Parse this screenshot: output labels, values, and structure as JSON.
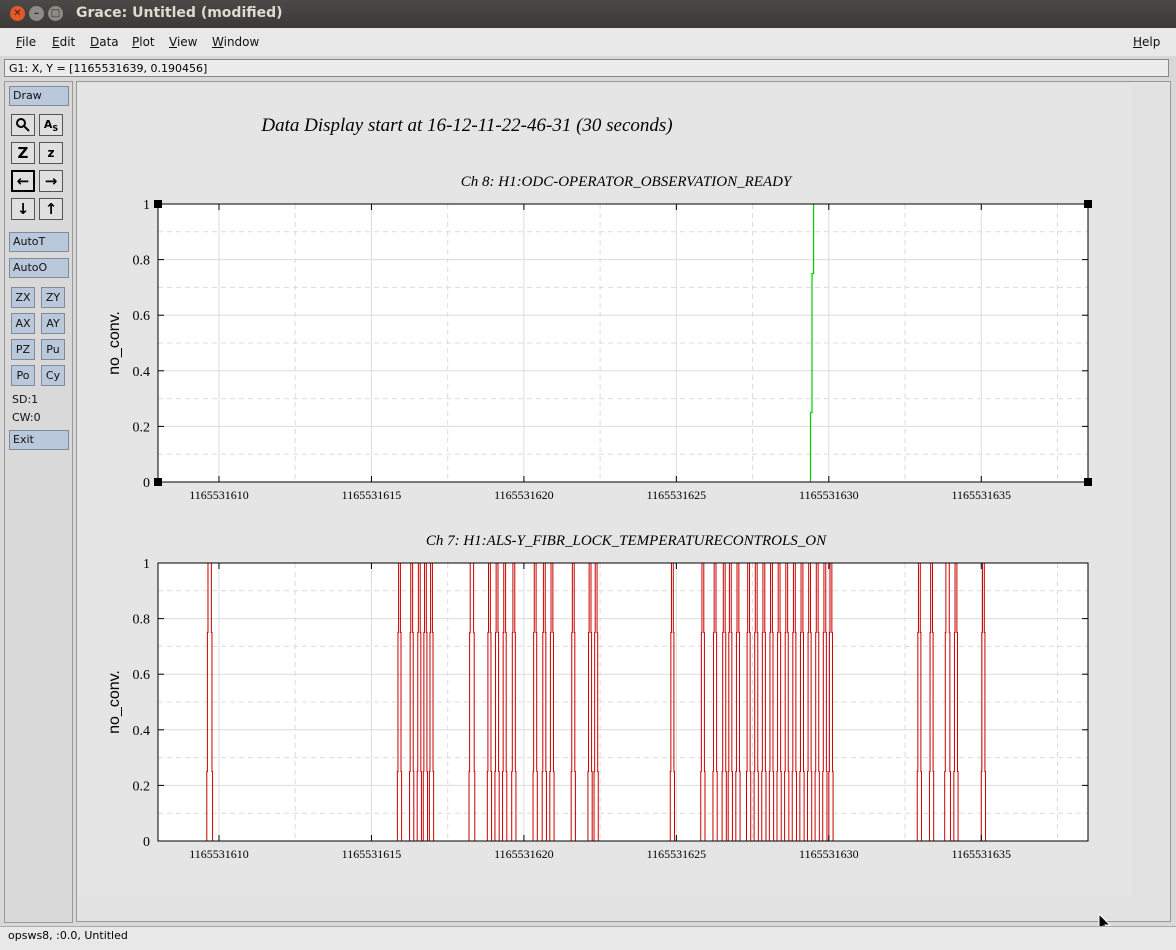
{
  "window": {
    "title": "Grace: Untitled (modified)"
  },
  "menu": {
    "file": "File",
    "edit": "Edit",
    "data": "Data",
    "plot": "Plot",
    "view": "View",
    "window": "Window",
    "help": "Help"
  },
  "locator": "G1: X, Y = [1165531639, 0.190456]",
  "toolbar": {
    "draw": "Draw",
    "autot": "AutoT",
    "autoo": "AutoO",
    "zx": "ZX",
    "zy": "ZY",
    "ax": "AX",
    "ay": "AY",
    "pz": "PZ",
    "pu": "Pu",
    "po": "Po",
    "cy": "Cy",
    "sd": "SD:1",
    "cw": "CW:0",
    "exit": "Exit",
    "icons": [
      "zoom-icon",
      "autoscale-icon",
      "zoom-in-z-icon",
      "zoom-out-z-icon",
      "pan-left-icon",
      "pan-right-icon",
      "pan-down-icon",
      "pan-up-icon"
    ]
  },
  "plot_title": "Data Display start at 16-12-11-22-46-31 (30 seconds)",
  "status": "opsws8, :0.0, Untitled",
  "colors": {
    "ch8": "#00cc00",
    "ch7": "#cc0000"
  },
  "chart_data": [
    {
      "type": "line",
      "title": "Ch 8: H1:ODC-OPERATOR_OBSERVATION_READY",
      "ylabel": "no_conv.",
      "xlim": [
        1165531608,
        1165531638.5
      ],
      "ylim": [
        0,
        1
      ],
      "xticks": [
        1165531610,
        1165531615,
        1165531620,
        1165531625,
        1165531630,
        1165531635
      ],
      "xtick_labels": [
        "1165531610",
        "1165531615",
        "1165531620",
        "1165531625",
        "1165531630",
        "1165531635"
      ],
      "yticks": [
        0,
        0.2,
        0.4,
        0.6,
        0.8,
        1
      ],
      "ytick_labels": [
        "0",
        "0.2",
        "0.4",
        "0.6",
        "0.8",
        "1"
      ],
      "grid": true,
      "series": [
        {
          "x": [
            1165531629.4,
            1165531629.4,
            1165531629.45,
            1165531629.45,
            1165531629.5,
            1165531629.5
          ],
          "y": [
            0,
            0.25,
            0.25,
            0.75,
            0.75,
            1
          ]
        }
      ]
    },
    {
      "type": "line",
      "title": "Ch 7: H1:ALS-Y_FIBR_LOCK_TEMPERATURECONTROLS_ON",
      "ylabel": "no_conv.",
      "xlim": [
        1165531608,
        1165531638.5
      ],
      "ylim": [
        0,
        1
      ],
      "xticks": [
        1165531610,
        1165531615,
        1165531620,
        1165531625,
        1165531630,
        1165531635
      ],
      "xtick_labels": [
        "1165531610",
        "1165531615",
        "1165531620",
        "1165531625",
        "1165531630",
        "1165531635"
      ],
      "yticks": [
        0,
        0.2,
        0.4,
        0.6,
        0.8,
        1
      ],
      "ytick_labels": [
        "0",
        "0.2",
        "0.4",
        "0.6",
        "0.8",
        "1"
      ],
      "grid": true,
      "pulses": [
        [
          1165531609.6,
          1165531609.75
        ],
        [
          1165531615.85,
          1165531615.95
        ],
        [
          1165531616.25,
          1165531616.35
        ],
        [
          1165531616.5,
          1165531616.6
        ],
        [
          1165531616.7,
          1165531616.8
        ],
        [
          1165531616.9,
          1165531617.0
        ],
        [
          1165531618.2,
          1165531618.35
        ],
        [
          1165531618.8,
          1165531618.9
        ],
        [
          1165531619.05,
          1165531619.15
        ],
        [
          1165531619.3,
          1165531619.4
        ],
        [
          1165531619.6,
          1165531619.7
        ],
        [
          1165531620.3,
          1165531620.4
        ],
        [
          1165531620.6,
          1165531620.7
        ],
        [
          1165531620.85,
          1165531620.95
        ],
        [
          1165531621.55,
          1165531621.65
        ],
        [
          1165531622.1,
          1165531622.2
        ],
        [
          1165531622.3,
          1165531622.4
        ],
        [
          1165531624.8,
          1165531624.9
        ],
        [
          1165531625.8,
          1165531625.9
        ],
        [
          1165531626.2,
          1165531626.3
        ],
        [
          1165531626.5,
          1165531626.6
        ],
        [
          1165531626.7,
          1165531626.8
        ],
        [
          1165531626.95,
          1165531627.05
        ],
        [
          1165531627.3,
          1165531627.4
        ],
        [
          1165531627.55,
          1165531627.65
        ],
        [
          1165531627.8,
          1165531627.9
        ],
        [
          1165531628.05,
          1165531628.15
        ],
        [
          1165531628.3,
          1165531628.4
        ],
        [
          1165531628.55,
          1165531628.65
        ],
        [
          1165531628.8,
          1165531628.9
        ],
        [
          1165531629.05,
          1165531629.15
        ],
        [
          1165531629.3,
          1165531629.4
        ],
        [
          1165531629.55,
          1165531629.65
        ],
        [
          1165531629.8,
          1165531629.9
        ],
        [
          1165531630.0,
          1165531630.1
        ],
        [
          1165531632.9,
          1165531633.0
        ],
        [
          1165531633.3,
          1165531633.4
        ],
        [
          1165531633.8,
          1165531633.95
        ],
        [
          1165531634.1,
          1165531634.2
        ],
        [
          1165531635.0,
          1165531635.1
        ]
      ]
    }
  ]
}
